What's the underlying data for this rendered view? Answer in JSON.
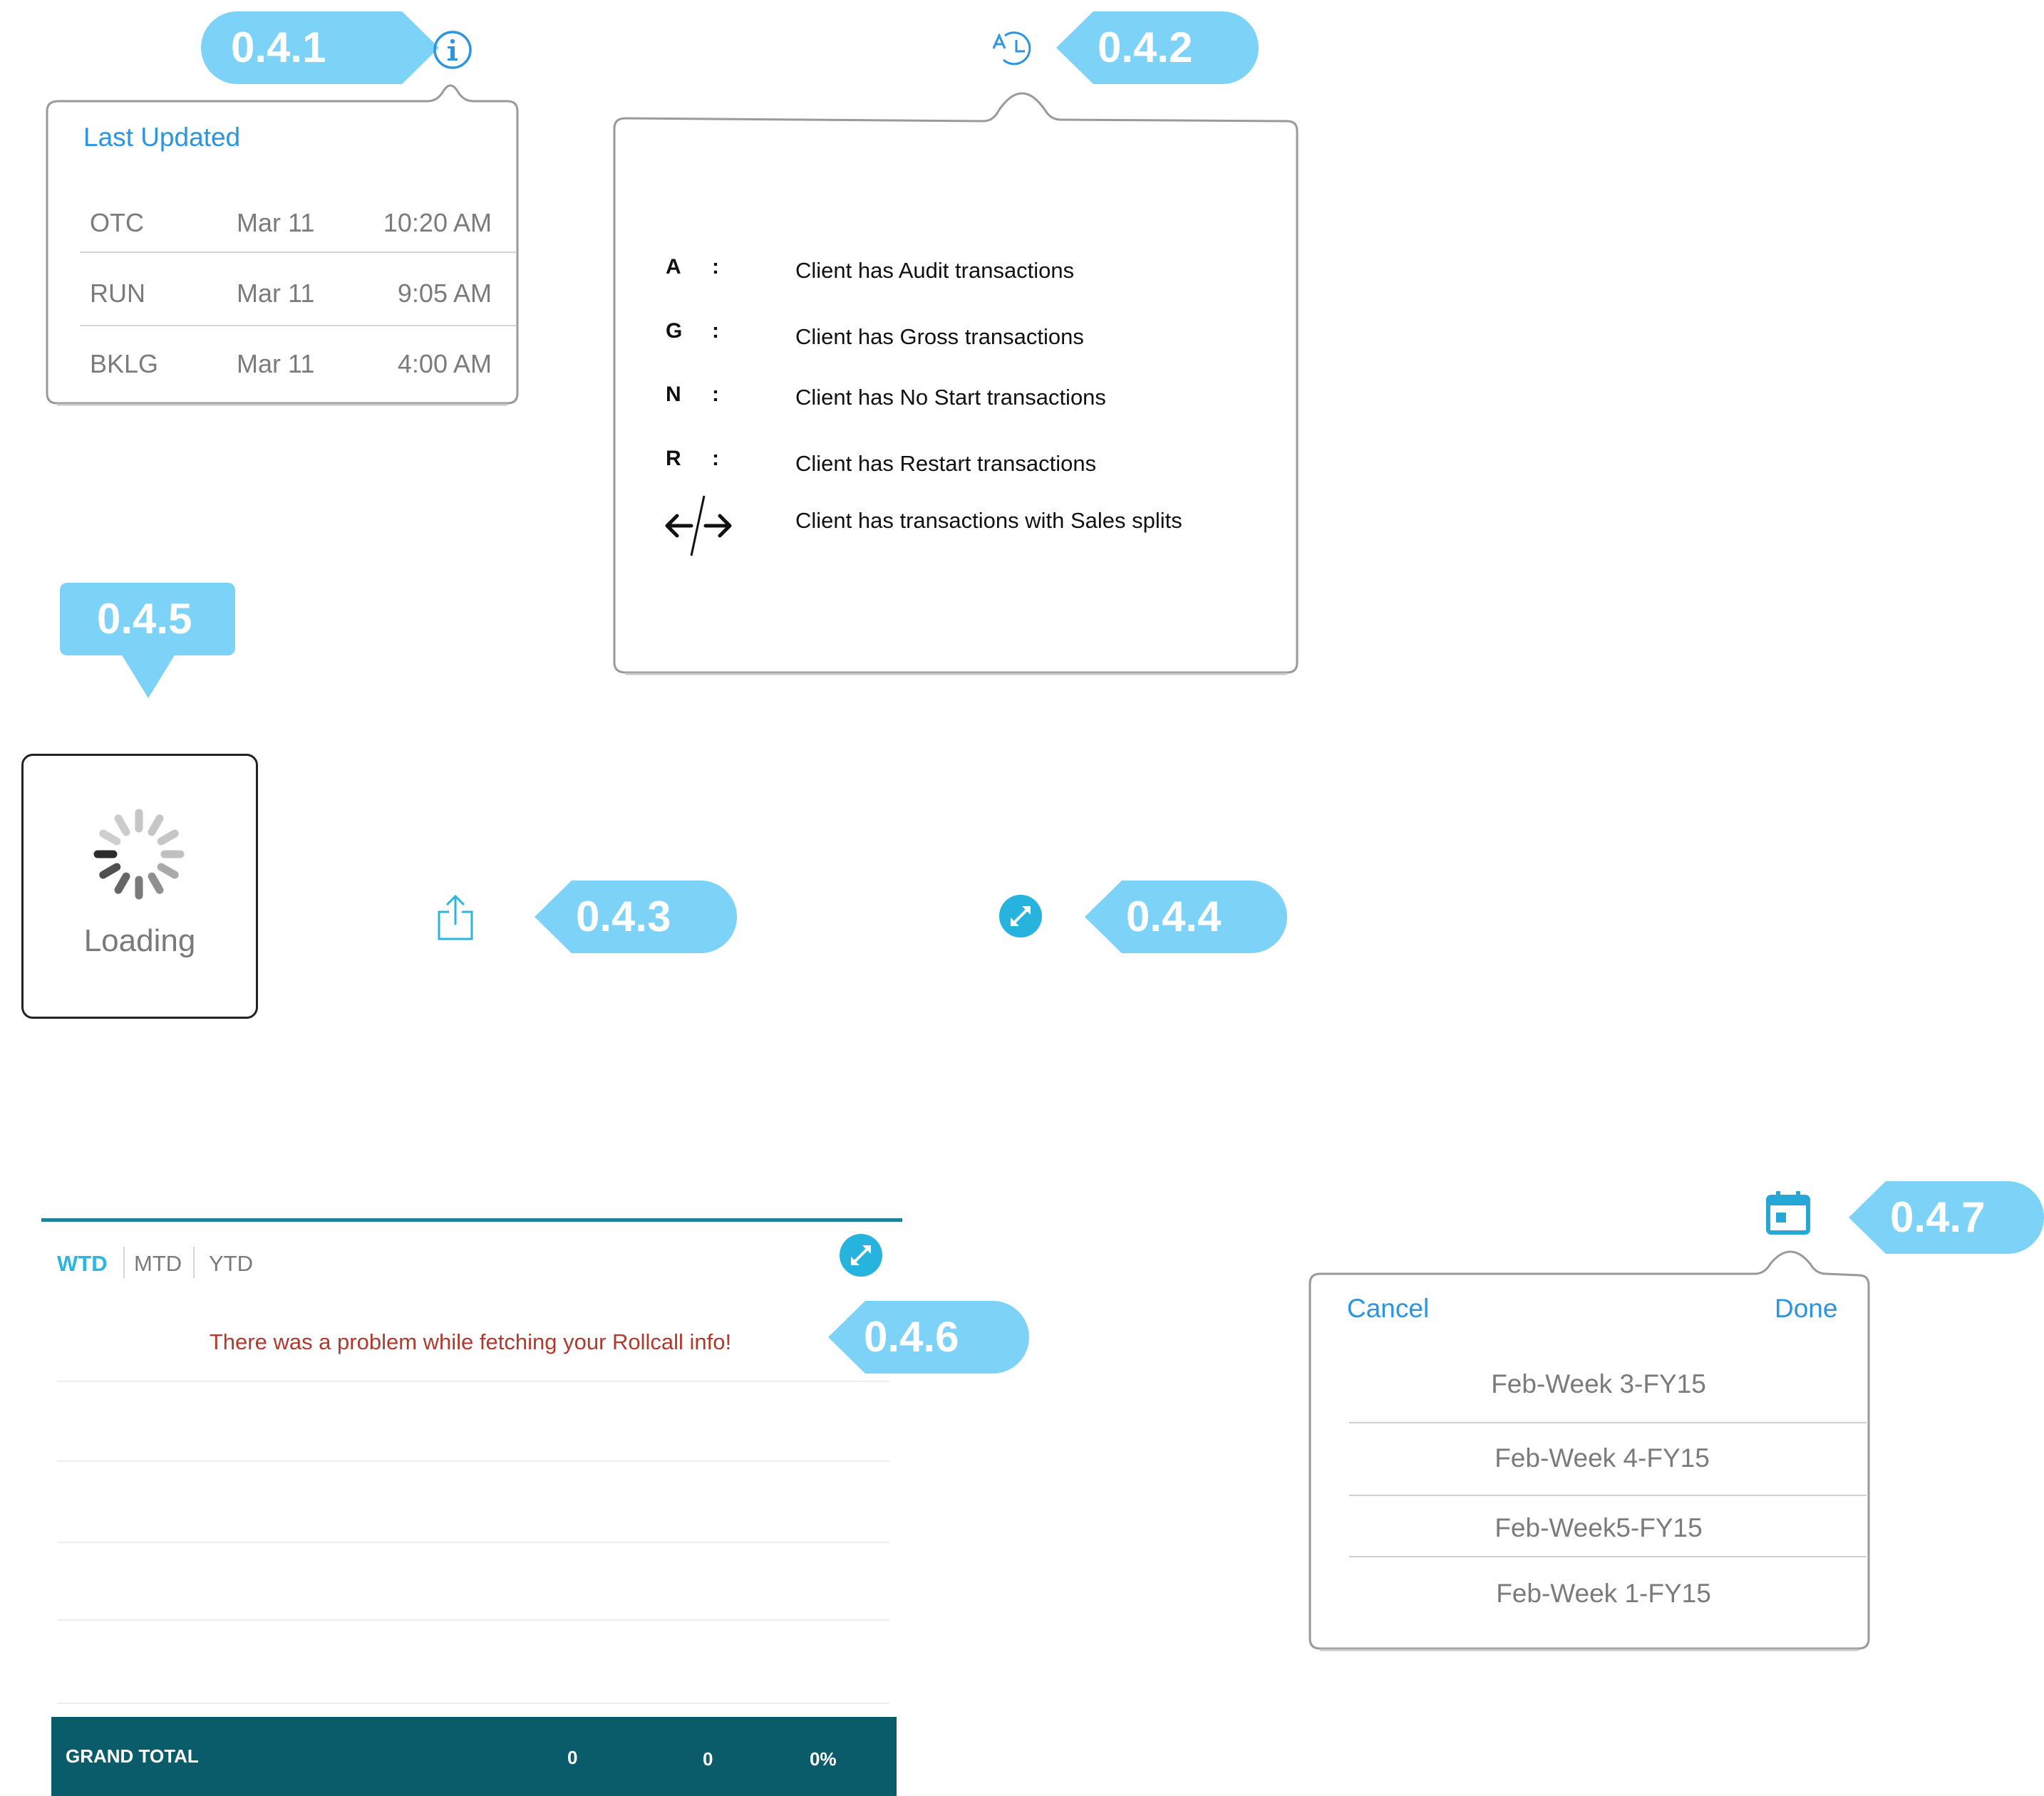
{
  "tags": {
    "t041": "0.4.1",
    "t042": "0.4.2",
    "t043": "0.4.3",
    "t044": "0.4.4",
    "t045": "0.4.5",
    "t046": "0.4.6",
    "t047": "0.4.7"
  },
  "colors": {
    "tag": "#7dd3f7",
    "link_blue": "#2b95dd",
    "teal_dark": "#0b5c6b",
    "teal_line": "#1b8597",
    "error_red": "#b03a2e",
    "icon_cyan": "#26b3dd"
  },
  "last_updated": {
    "title": "Last Updated",
    "rows": [
      {
        "name": "OTC",
        "date": "Mar 11",
        "time": "10:20 AM"
      },
      {
        "name": "RUN",
        "date": "Mar 11",
        "time": "9:05 AM"
      },
      {
        "name": "BKLG",
        "date": "Mar 11",
        "time": "4:00 AM"
      }
    ]
  },
  "legend": {
    "items": [
      {
        "key": "A",
        "colon": ":",
        "text": "Client has Audit transactions"
      },
      {
        "key": "G",
        "colon": ":",
        "text": "Client has Gross transactions"
      },
      {
        "key": "N",
        "colon": ":",
        "text": "Client has No Start transactions"
      },
      {
        "key": "R",
        "colon": ":",
        "text": "Client has Restart transactions"
      }
    ],
    "splits_text": "Client has transactions with Sales splits"
  },
  "loading": {
    "label": "Loading"
  },
  "rollcall": {
    "tabs": [
      "WTD",
      "MTD",
      "YTD"
    ],
    "active_tab": "WTD",
    "error": "There was a problem while fetching your Rollcall info!",
    "grand_total": {
      "label": "GRAND TOTAL",
      "v1": "0",
      "v2": "0",
      "v3": "0%"
    }
  },
  "picker": {
    "cancel": "Cancel",
    "done": "Done",
    "weeks": [
      "Feb-Week 3-FY15",
      "Feb-Week 4-FY15",
      "Feb-Week5-FY15",
      "Feb-Week 1-FY15"
    ]
  },
  "icons": {
    "info": "info-icon",
    "legend": "legend-icon",
    "share": "share-icon",
    "expand": "expand-icon",
    "calendar": "calendar-icon",
    "spinner": "spinner-icon",
    "splits": "sales-splits-icon"
  }
}
